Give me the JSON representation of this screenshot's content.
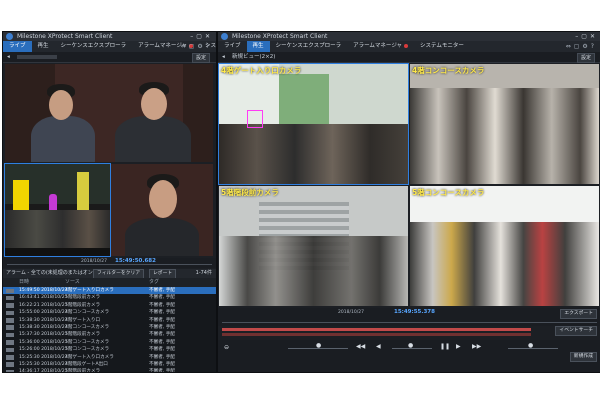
{
  "app": {
    "title": "Milestone XProtect Smart Client"
  },
  "left": {
    "tabs": [
      {
        "label": "ライブ",
        "active": true
      },
      {
        "label": "再生",
        "active": false
      },
      {
        "label": "シーケンスエクスプローラ",
        "active": false
      },
      {
        "label": "アラームマネージャ",
        "active": false,
        "alert": true
      },
      {
        "label": "システムモニター",
        "active": false
      }
    ],
    "toolbar_button": "設定",
    "playback": {
      "date": "2018/10/27",
      "time": "15:49:50.682"
    },
    "alarms": {
      "filter_label": "アラーム - 全ての(未処理のまたはオンの)",
      "filter_button": "フィルターをクリア",
      "report_button": "レポート",
      "page_info": "1-74件",
      "columns": [
        "日時",
        "ソース",
        "タグ"
      ],
      "rows": [
        {
          "time": "15:49:50 2018/10/27",
          "source": "4階ゲート入り口カメラ",
          "tag": "不審者, 手配",
          "selected": true
        },
        {
          "time": "16:43:41 2018/10/27",
          "source": "5階階段前カメラ",
          "tag": "不審者, 手配",
          "selected": false
        },
        {
          "time": "16:22:21 2018/10/27",
          "source": "5階階段前カメラ",
          "tag": "不審者, 手配",
          "selected": false
        },
        {
          "time": "15:55:00 2018/10/27",
          "source": "4階コンコースカメラ",
          "tag": "不審者, 手配",
          "selected": false
        },
        {
          "time": "15:38:30 2018/10/27",
          "source": "4階ゲート入り口",
          "tag": "不審者, 手配",
          "selected": false
        },
        {
          "time": "15:38:30 2018/10/27",
          "source": "4階コンコースカメラ",
          "tag": "不審者, 手配",
          "selected": false
        },
        {
          "time": "15:37:30 2018/10/27",
          "source": "5階階段前カメラ",
          "tag": "不審者, 手配",
          "selected": false
        },
        {
          "time": "15:36:00 2018/10/27",
          "source": "5階コンコースカメラ",
          "tag": "不審者, 手配",
          "selected": false
        },
        {
          "time": "15:26:00 2018/10/27",
          "source": "5階コンコースカメラ",
          "tag": "不審者, 手配",
          "selected": false
        },
        {
          "time": "15:25:30 2018/10/27",
          "source": "4階ゲート入り口カメラ",
          "tag": "不審者, 手配",
          "selected": false
        },
        {
          "time": "15:25:30 2018/10/27",
          "source": "4階階段ゲートA出口",
          "tag": "不審者, 手配",
          "selected": false
        },
        {
          "time": "14:36:17 2018/10/27",
          "source": "5階階段前カメラ",
          "tag": "不審者, 手配",
          "selected": false
        },
        {
          "time": "14:32:00 2018/10/27",
          "source": "4階コンコースカメラ",
          "tag": "不審者, 手配",
          "selected": false
        },
        {
          "time": "14:30:00 2018/10/27",
          "source": "5階コンコースカメラ",
          "tag": "不審者, 手配",
          "selected": false
        }
      ]
    }
  },
  "right": {
    "tabs": [
      {
        "label": "ライブ",
        "active": false
      },
      {
        "label": "再生",
        "active": true
      },
      {
        "label": "シーケンスエクスプローラ",
        "active": false
      },
      {
        "label": "アラームマネージャ",
        "active": false,
        "alert": true
      },
      {
        "label": "システムモニター",
        "active": false
      }
    ],
    "view_name": "新規ビュー(2×2)",
    "toolbar_button": "設定",
    "cameras": [
      {
        "label": "4階ゲート入り口カメラ"
      },
      {
        "label": "4階コンコースカメラ"
      },
      {
        "label": "5階階段前カメラ"
      },
      {
        "label": "5階コンコースカメラ"
      }
    ],
    "playback": {
      "date": "2018/10/27",
      "time": "15:49:55.378"
    },
    "buttons": {
      "export": "エクスポート",
      "search": "イベントサーチ",
      "add": "新規作成"
    }
  }
}
